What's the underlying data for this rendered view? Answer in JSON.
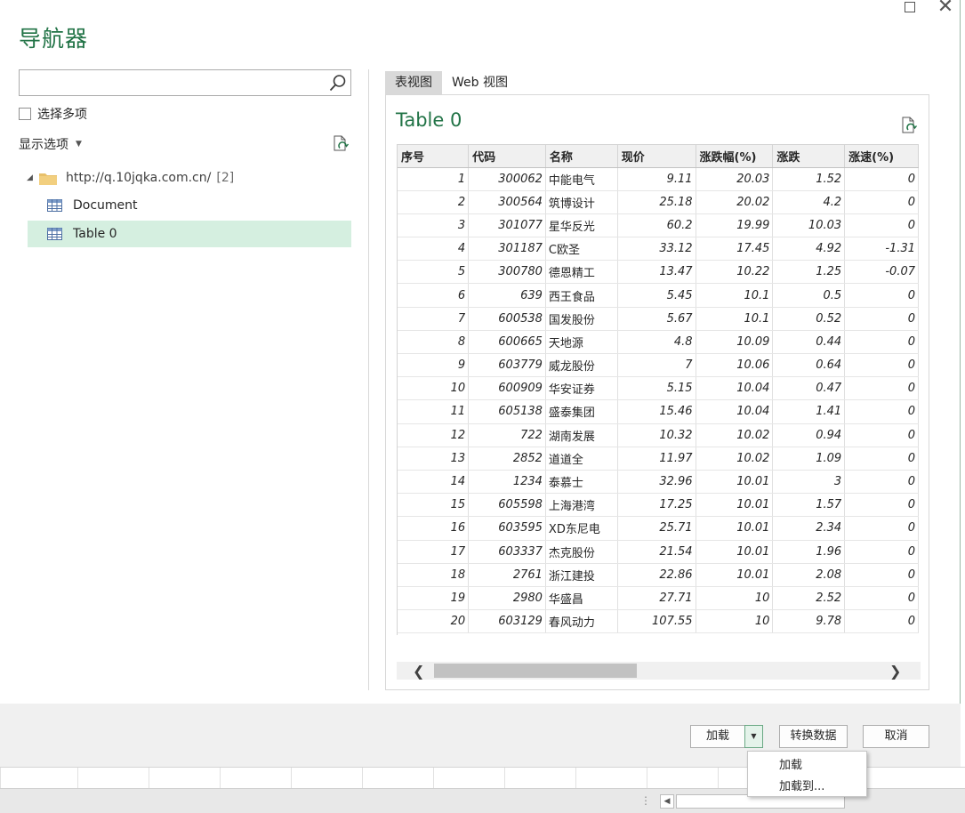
{
  "dialog": {
    "title": "导航器",
    "window_controls": [
      "maximize",
      "close"
    ],
    "close_glyph": "✕"
  },
  "left_pane": {
    "search": {
      "placeholder": "",
      "value": "",
      "icon": "search-icon"
    },
    "multi_select_label": "选择多项",
    "display_options_label": "显示选项",
    "tree": {
      "root": {
        "label": "http://q.10jqka.com.cn/",
        "count": "[2]"
      },
      "items": [
        {
          "label": "Document",
          "selected": false
        },
        {
          "label": "Table 0",
          "selected": true
        }
      ]
    }
  },
  "right_pane": {
    "tabs": [
      {
        "label": "表视图",
        "active": true
      },
      {
        "label": "Web 视图",
        "active": false
      }
    ],
    "preview_title": "Table 0",
    "table": {
      "columns": [
        "序号",
        "代码",
        "名称",
        "现价",
        "涨跌幅(%)",
        "涨跌",
        "涨速(%)"
      ],
      "rows": [
        [
          "1",
          "300062",
          "中能电气",
          "9.11",
          "20.03",
          "1.52",
          "0"
        ],
        [
          "2",
          "300564",
          "筑博设计",
          "25.18",
          "20.02",
          "4.2",
          "0"
        ],
        [
          "3",
          "301077",
          "星华反光",
          "60.2",
          "19.99",
          "10.03",
          "0"
        ],
        [
          "4",
          "301187",
          "C欧圣",
          "33.12",
          "17.45",
          "4.92",
          "-1.31"
        ],
        [
          "5",
          "300780",
          "德恩精工",
          "13.47",
          "10.22",
          "1.25",
          "-0.07"
        ],
        [
          "6",
          "639",
          "西王食品",
          "5.45",
          "10.1",
          "0.5",
          "0"
        ],
        [
          "7",
          "600538",
          "国发股份",
          "5.67",
          "10.1",
          "0.52",
          "0"
        ],
        [
          "8",
          "600665",
          "天地源",
          "4.8",
          "10.09",
          "0.44",
          "0"
        ],
        [
          "9",
          "603779",
          "威龙股份",
          "7",
          "10.06",
          "0.64",
          "0"
        ],
        [
          "10",
          "600909",
          "华安证券",
          "5.15",
          "10.04",
          "0.47",
          "0"
        ],
        [
          "11",
          "605138",
          "盛泰集团",
          "15.46",
          "10.04",
          "1.41",
          "0"
        ],
        [
          "12",
          "722",
          "湖南发展",
          "10.32",
          "10.02",
          "0.94",
          "0"
        ],
        [
          "13",
          "2852",
          "道道全",
          "11.97",
          "10.02",
          "1.09",
          "0"
        ],
        [
          "14",
          "1234",
          "泰慕士",
          "32.96",
          "10.01",
          "3",
          "0"
        ],
        [
          "15",
          "605598",
          "上海港湾",
          "17.25",
          "10.01",
          "1.57",
          "0"
        ],
        [
          "16",
          "603595",
          "XD东尼电",
          "25.71",
          "10.01",
          "2.34",
          "0"
        ],
        [
          "17",
          "603337",
          "杰克股份",
          "21.54",
          "10.01",
          "1.96",
          "0"
        ],
        [
          "18",
          "2761",
          "浙江建投",
          "22.86",
          "10.01",
          "2.08",
          "0"
        ],
        [
          "19",
          "2980",
          "华盛昌",
          "27.71",
          "10",
          "2.52",
          "0"
        ],
        [
          "20",
          "603129",
          "春风动力",
          "107.55",
          "10",
          "9.78",
          "0"
        ]
      ]
    },
    "scroll": {
      "left_glyph": "❮",
      "right_glyph": "❯"
    }
  },
  "footer": {
    "load_label": "加载",
    "load_dropdown_glyph": "▼",
    "transform_label": "转换数据",
    "cancel_label": "取消"
  },
  "load_menu": {
    "items": [
      "加载",
      "加载到..."
    ]
  },
  "colors": {
    "accent": "#217346",
    "selection": "#d5efe0"
  }
}
